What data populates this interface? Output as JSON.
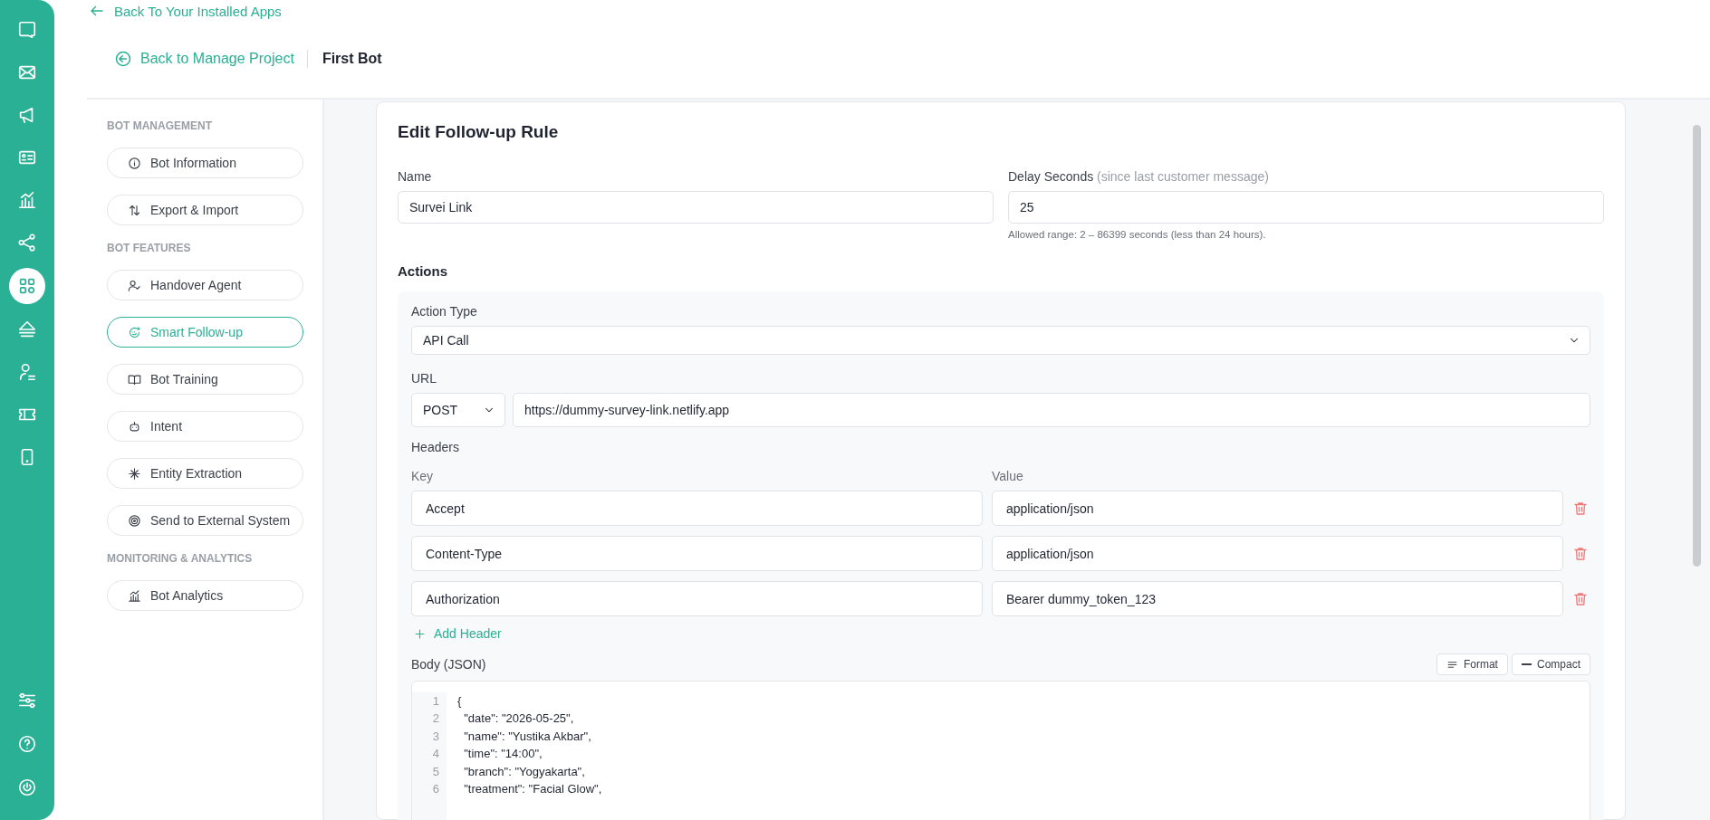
{
  "top_link": {
    "label": "Back To Your Installed Apps"
  },
  "rail": {
    "items": [
      {
        "selected": false
      },
      {
        "selected": false
      },
      {
        "selected": false
      },
      {
        "selected": false
      },
      {
        "selected": false
      },
      {
        "selected": false
      },
      {
        "selected": true
      },
      {
        "selected": false
      },
      {
        "selected": false
      },
      {
        "selected": false
      },
      {
        "selected": false
      }
    ]
  },
  "breadcrumb": {
    "back_label": "Back to Manage Project",
    "current": "First Bot"
  },
  "sidebar": {
    "sections": [
      {
        "title": "BOT MANAGEMENT",
        "items": [
          {
            "label": "Bot Information",
            "selected": false
          },
          {
            "label": "Export & Import",
            "selected": false
          }
        ]
      },
      {
        "title": "BOT FEATURES",
        "items": [
          {
            "label": "Handover Agent",
            "selected": false
          },
          {
            "label": "Smart Follow-up",
            "selected": true
          },
          {
            "label": "Bot Training",
            "selected": false
          },
          {
            "label": "Intent",
            "selected": false
          },
          {
            "label": "Entity Extraction",
            "selected": false
          },
          {
            "label": "Send to External System",
            "selected": false
          }
        ]
      },
      {
        "title": "MONITORING & ANALYTICS",
        "items": [
          {
            "label": "Bot Analytics",
            "selected": false
          }
        ]
      }
    ]
  },
  "form": {
    "title": "Edit Follow-up Rule",
    "name": {
      "label": "Name",
      "value": "Survei Link"
    },
    "delay": {
      "label": "Delay Seconds",
      "hint": "(since last customer message)",
      "value": "25",
      "help": "Allowed range: 2 – 86399 seconds (less than 24 hours)."
    },
    "actions": {
      "title": "Actions",
      "action_type": {
        "label": "Action Type",
        "value": "API Call"
      },
      "url": {
        "label": "URL",
        "method": "POST",
        "value": "https://dummy-survey-link.netlify.app"
      },
      "headers": {
        "title": "Headers",
        "key_label": "Key",
        "value_label": "Value",
        "rows": [
          {
            "key": "Accept",
            "value": "application/json"
          },
          {
            "key": "Content-Type",
            "value": "application/json"
          },
          {
            "key": "Authorization",
            "value": "Bearer dummy_token_123"
          }
        ],
        "add_label": "Add Header"
      },
      "body": {
        "title": "Body (JSON)",
        "buttons": [
          {
            "kind": "format",
            "label": "Format"
          },
          {
            "kind": "compact",
            "label": "Compact"
          }
        ],
        "lines": [
          {
            "number": "1",
            "text": "{"
          },
          {
            "number": "2",
            "text": "  \"date\": \"2026-05-25\","
          },
          {
            "number": "3",
            "text": "  \"name\": \"Yustika Akbar\","
          },
          {
            "number": "4",
            "text": "  \"time\": \"14:00\","
          },
          {
            "number": "5",
            "text": "  \"branch\": \"Yogyakarta\","
          },
          {
            "number": "6",
            "text": "  \"treatment\": \"Facial Glow\","
          }
        ]
      }
    }
  }
}
